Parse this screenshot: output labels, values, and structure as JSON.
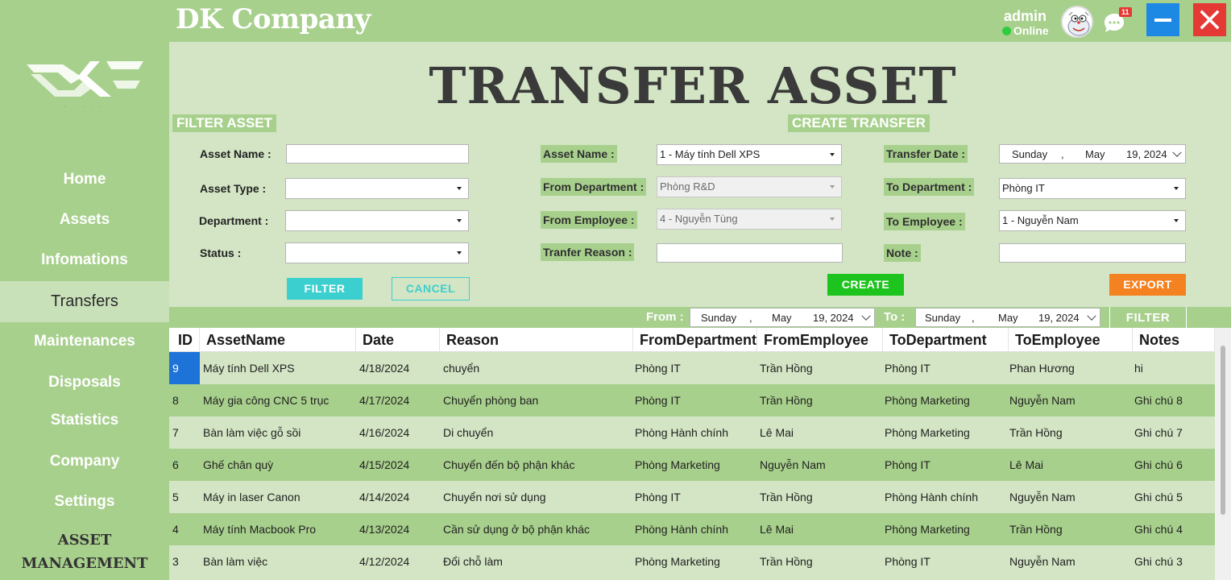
{
  "app": {
    "brand": "DK Company"
  },
  "user": {
    "name": "admin",
    "status": "Online",
    "notifications": "11"
  },
  "sidebar": {
    "items": [
      {
        "label": "Home"
      },
      {
        "label": "Assets"
      },
      {
        "label": "Infomations"
      },
      {
        "label": "Transfers"
      },
      {
        "label": "Maintenances"
      },
      {
        "label": "Disposals"
      },
      {
        "label": "Statistics"
      },
      {
        "label": "Company"
      },
      {
        "label": "Settings"
      }
    ],
    "footer_line1": "ASSET",
    "footer_line2": "MANAGEMENT"
  },
  "page": {
    "title": "TRANSFER ASSET"
  },
  "filter": {
    "section_label": "FILTER ASSET",
    "asset_name_label": "Asset Name :",
    "asset_name_value": "",
    "asset_type_label": "Asset Type :",
    "asset_type_value": "",
    "department_label": "Department :",
    "department_value": "",
    "status_label": "Status :",
    "status_value": "",
    "filter_button": "FILTER",
    "cancel_button": "CANCEL"
  },
  "create": {
    "section_label": "CREATE TRANSFER",
    "asset_name_label": "Asset Name :",
    "asset_name_value": "1 - Máy tính Dell XPS",
    "from_department_label": "From Department :",
    "from_department_value": "Phòng R&D",
    "from_employee_label": "From Employee :",
    "from_employee_value": "4 - Nguyễn Tùng",
    "reason_label": "Tranfer Reason :",
    "reason_value": "",
    "transfer_date_label": "Transfer Date :",
    "transfer_date": {
      "day": "Sunday",
      "sep": ",",
      "month": "May",
      "daynum": "19, 2024"
    },
    "to_department_label": "To Department :",
    "to_department_value": "Phòng IT",
    "to_employee_label": "To Employee :",
    "to_employee_value": "1 - Nguyễn Nam",
    "note_label": "Note :",
    "note_value": "",
    "create_button": "CREATE",
    "export_button": "EXPORT"
  },
  "date_filter": {
    "from_label": "From :",
    "from_date": {
      "day": "Sunday",
      "sep": ",",
      "month": "May",
      "daynum": "19, 2024"
    },
    "to_label": "To :",
    "to_date": {
      "day": "Sunday",
      "sep": ",",
      "month": "May",
      "daynum": "19, 2024"
    },
    "filter_button": "FILTER"
  },
  "table": {
    "columns": [
      "ID",
      "AssetName",
      "Date",
      "Reason",
      "FromDepartment",
      "FromEmployee",
      "ToDepartment",
      "ToEmployee",
      "Notes"
    ],
    "rows": [
      [
        "9",
        "Máy tính Dell XPS",
        "4/18/2024",
        "chuyển",
        "Phòng IT",
        "Trần Hồng",
        "Phòng IT",
        "Phan Hương",
        "hi"
      ],
      [
        "8",
        "Máy gia công CNC 5 trục",
        "4/17/2024",
        "Chuyển phòng ban",
        "Phòng IT",
        "Trần Hồng",
        "Phòng Marketing",
        "Nguyễn Nam",
        "Ghi chú 8"
      ],
      [
        "7",
        "Bàn làm việc gỗ sồi",
        "4/16/2024",
        "Di chuyển",
        "Phòng Hành chính",
        "Lê Mai",
        "Phòng Marketing",
        "Trần Hồng",
        "Ghi chú 7"
      ],
      [
        "6",
        "Ghế chân quỳ",
        "4/15/2024",
        "Chuyển đến bộ phận khác",
        "Phòng Marketing",
        "Nguyễn Nam",
        "Phòng IT",
        "Lê Mai",
        "Ghi chú 6"
      ],
      [
        "5",
        "Máy in laser Canon",
        "4/14/2024",
        "Chuyển nơi sử dụng",
        "Phòng IT",
        "Trần Hồng",
        "Phòng Hành chính",
        "Nguyễn Nam",
        "Ghi chú 5"
      ],
      [
        "4",
        "Máy tính Macbook Pro",
        "4/13/2024",
        "Cần sử dụng ở bộ phận khác",
        "Phòng Hành chính",
        "Lê Mai",
        "Phòng Marketing",
        "Trần Hồng",
        "Ghi chú 4"
      ],
      [
        "3",
        "Bàn làm việc",
        "4/12/2024",
        "Đổi chỗ làm",
        "Phòng Marketing",
        "Trần Hồng",
        "Phòng IT",
        "Nguyễn Nam",
        "Ghi chú 3"
      ]
    ]
  },
  "colors": {
    "primary_green": "#a8d08d",
    "light_green": "#d3e5c4",
    "filter_button": "#3ccfcf",
    "create_button": "#1ec41e",
    "export_button": "#f58220",
    "minimize_button": "#1e88e5",
    "close_button": "#e53935",
    "selected_cell": "#1e73d8"
  },
  "icons": {
    "logo": "dk-logo",
    "avatar": "user-avatar",
    "chat": "chat-bubble-icon",
    "minimize": "minimize-icon",
    "close": "close-icon",
    "dropdown": "chevron-down-icon"
  }
}
